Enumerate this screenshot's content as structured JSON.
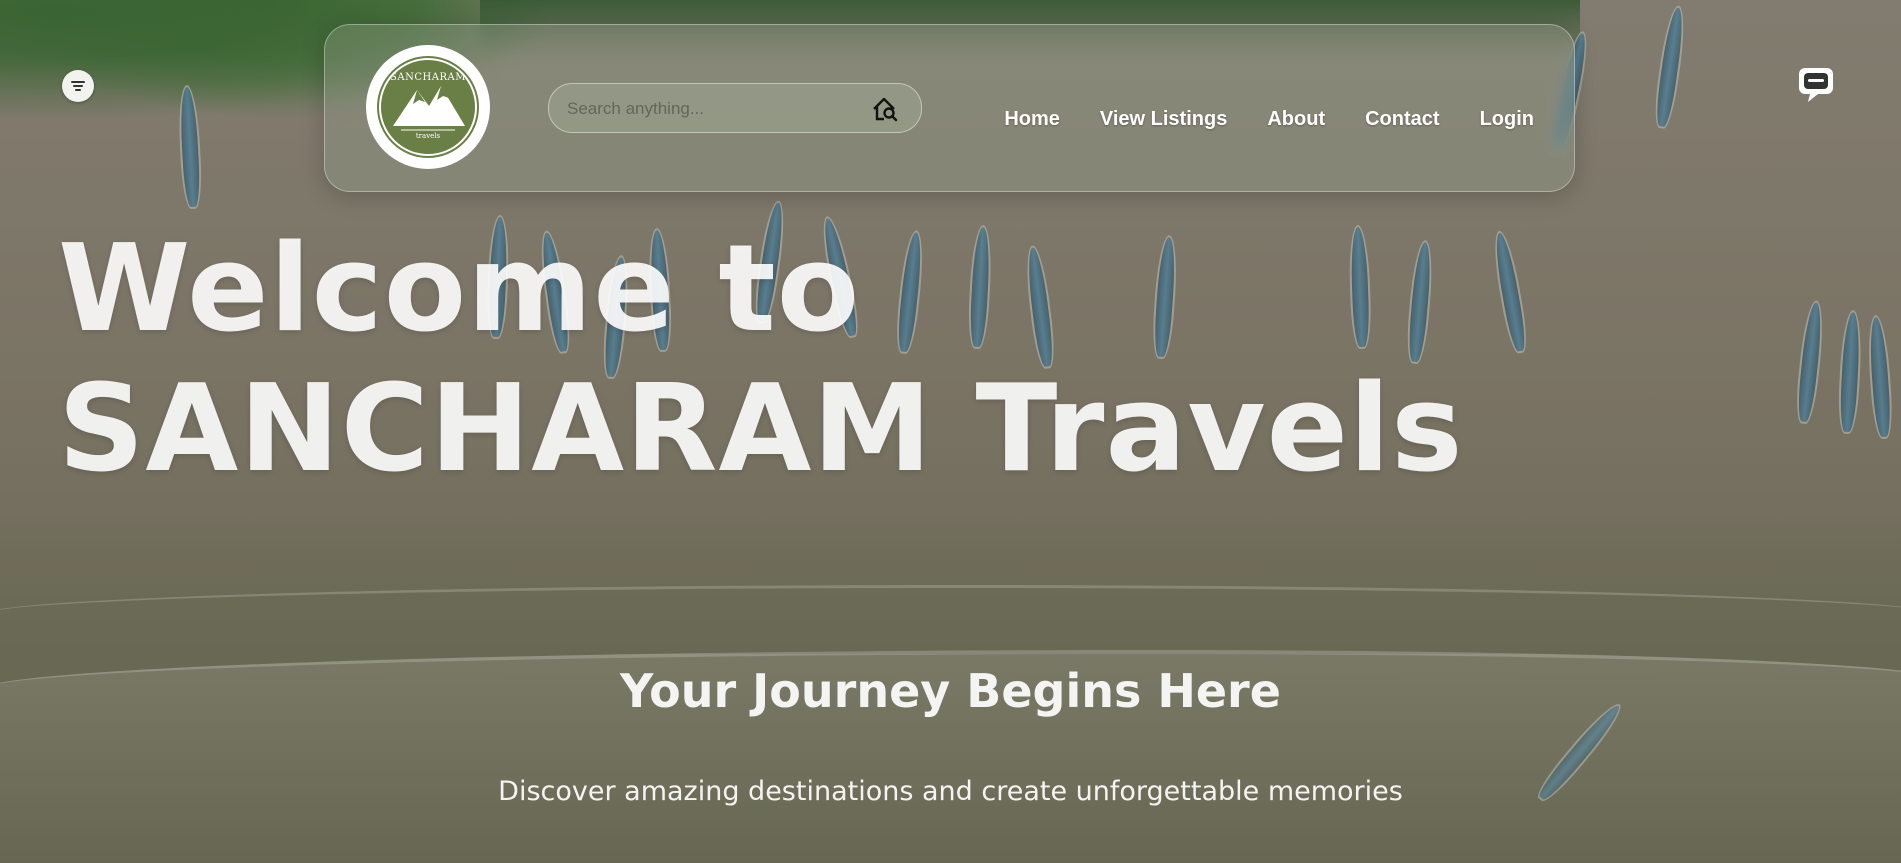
{
  "header": {
    "logo": {
      "brand": "SANCHARAM",
      "sub": "travels"
    },
    "search": {
      "placeholder": "Search anything..."
    },
    "nav": [
      {
        "label": "Home"
      },
      {
        "label": "View Listings"
      },
      {
        "label": "About"
      },
      {
        "label": "Contact"
      },
      {
        "label": "Login"
      }
    ]
  },
  "hero": {
    "title": "Welcome to SANCHARAM Travels",
    "subtitle": "Your Journey Begins Here",
    "description": "Discover amazing destinations and create unforgettable memories"
  },
  "icons": {
    "filter": "filter-icon",
    "chat": "chat-icon",
    "search": "home-search-icon"
  }
}
